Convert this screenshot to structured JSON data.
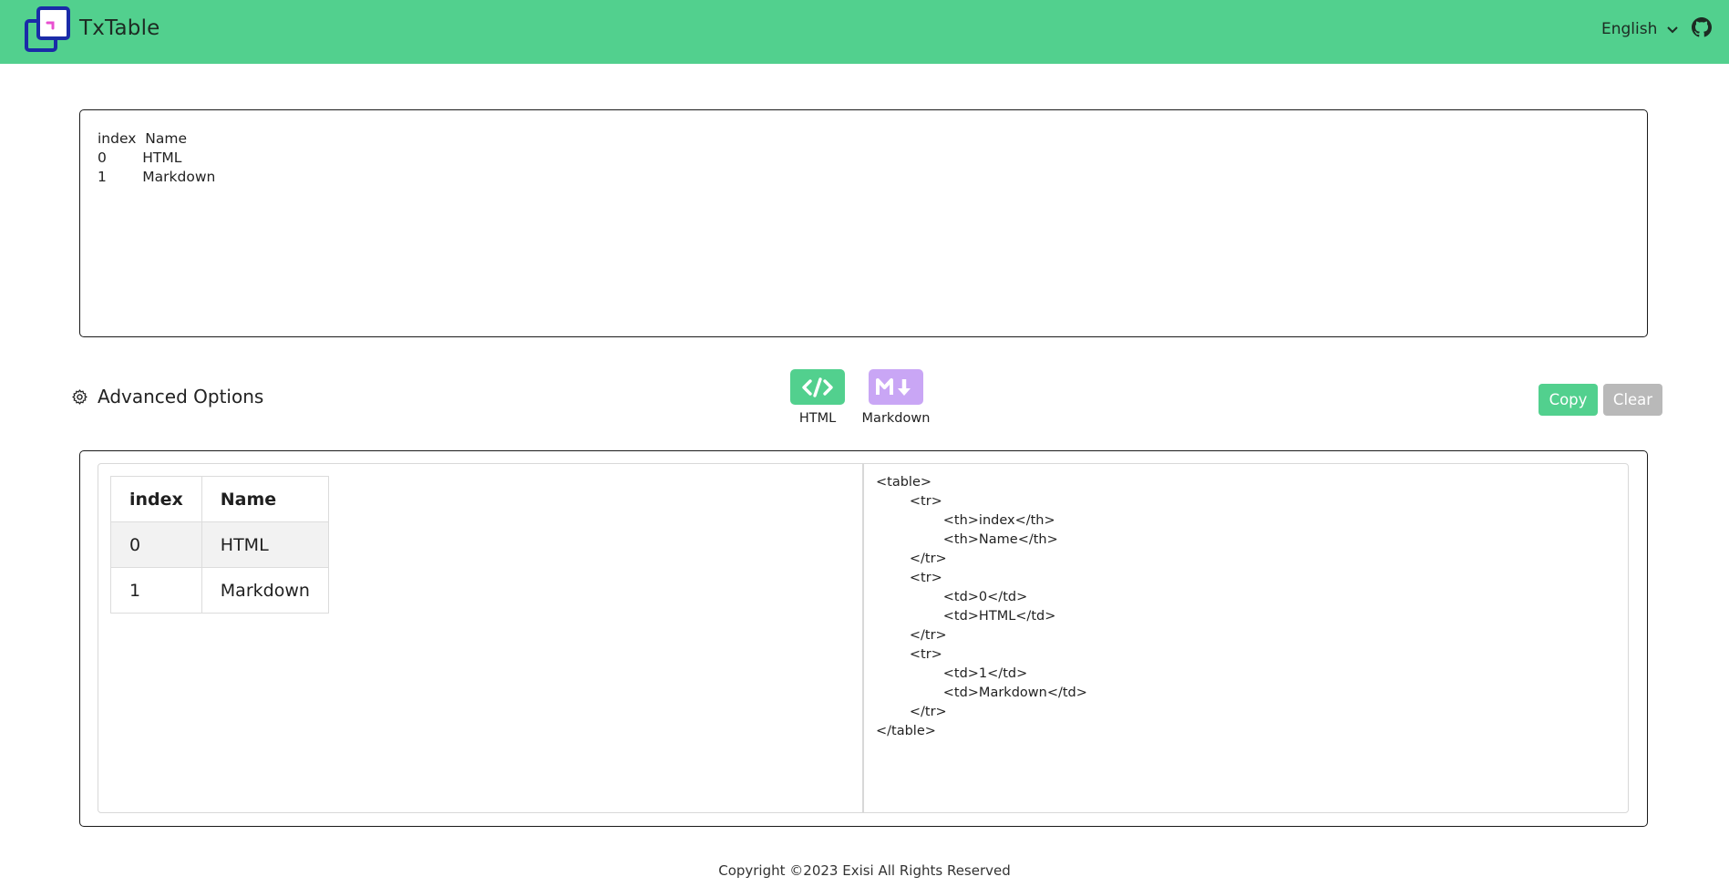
{
  "header": {
    "brand": "TxTable",
    "language": "English",
    "colors": {
      "bar": "#52d08e",
      "logo_frame": "#1a2ba8",
      "logo_accent": "#e84fd0"
    },
    "icons": {
      "logo": "txtable-logo-icon",
      "language": "chevron-down-icon",
      "repo": "github-icon"
    }
  },
  "input": {
    "value": "index  Name\n0        HTML\n1        Markdown"
  },
  "options": {
    "advanced_label": "Advanced Options",
    "advanced_icon": "gear-icon"
  },
  "formats": [
    {
      "label": "HTML",
      "icon": "code-icon",
      "color": "#52d08e"
    },
    {
      "label": "Markdown",
      "icon": "markdown-icon",
      "color": "#c9a6f5"
    }
  ],
  "actions": {
    "copy_label": "Copy",
    "clear_label": "Clear",
    "copy_color": "#52d08e",
    "clear_color": "#b9b9b9"
  },
  "preview_table": {
    "headers": [
      "index",
      "Name"
    ],
    "rows": [
      [
        "0",
        "HTML"
      ],
      [
        "1",
        "Markdown"
      ]
    ]
  },
  "code_output": "<table>\n        <tr>\n                <th>index</th>\n                <th>Name</th>\n        </tr>\n        <tr>\n                <td>0</td>\n                <td>HTML</td>\n        </tr>\n        <tr>\n                <td>1</td>\n                <td>Markdown</td>\n        </tr>\n</table>",
  "footer": {
    "copyright": "Copyright ©2023 Exisi All Rights Reserved"
  }
}
